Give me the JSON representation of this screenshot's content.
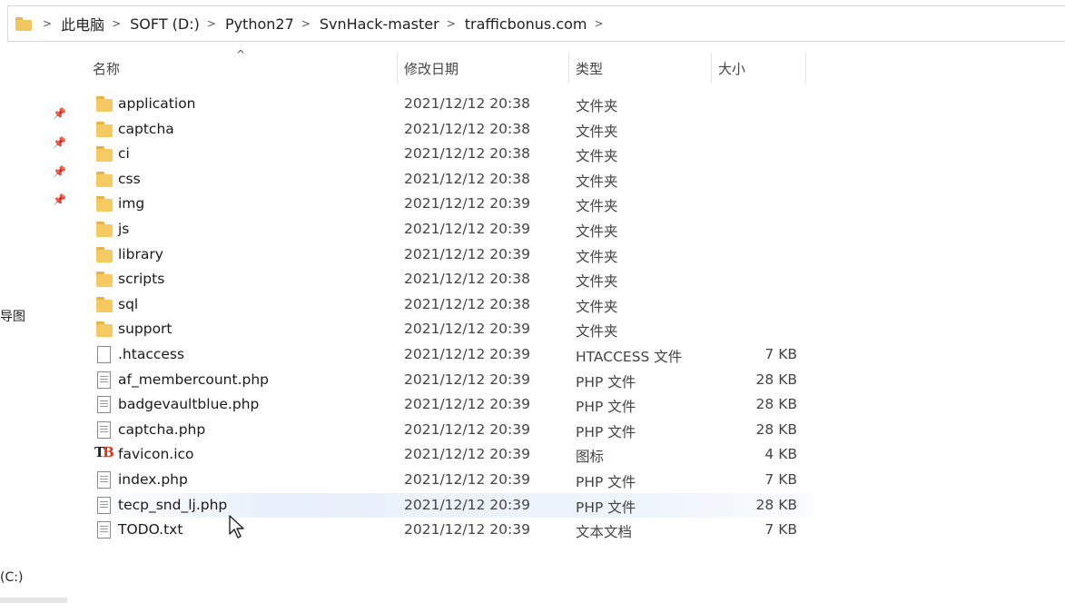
{
  "breadcrumb": [
    "此电脑",
    "SOFT (D:)",
    "Python27",
    "SvnHack-master",
    "trafficbonus.com"
  ],
  "columns": {
    "name": "名称",
    "date": "修改日期",
    "type": "类型",
    "size": "大小"
  },
  "nav_fragments": {
    "pane_item_1": "导图",
    "drive_c": "(C:)"
  },
  "files": [
    {
      "name": "application",
      "date": "2021/12/12 20:38",
      "type": "文件夹",
      "size": "",
      "icon": "folder-icon"
    },
    {
      "name": "captcha",
      "date": "2021/12/12 20:38",
      "type": "文件夹",
      "size": "",
      "icon": "folder-icon"
    },
    {
      "name": "ci",
      "date": "2021/12/12 20:38",
      "type": "文件夹",
      "size": "",
      "icon": "folder-icon"
    },
    {
      "name": "css",
      "date": "2021/12/12 20:38",
      "type": "文件夹",
      "size": "",
      "icon": "folder-icon"
    },
    {
      "name": "img",
      "date": "2021/12/12 20:39",
      "type": "文件夹",
      "size": "",
      "icon": "folder-icon"
    },
    {
      "name": "js",
      "date": "2021/12/12 20:39",
      "type": "文件夹",
      "size": "",
      "icon": "folder-icon"
    },
    {
      "name": "library",
      "date": "2021/12/12 20:39",
      "type": "文件夹",
      "size": "",
      "icon": "folder-icon"
    },
    {
      "name": "scripts",
      "date": "2021/12/12 20:38",
      "type": "文件夹",
      "size": "",
      "icon": "folder-icon"
    },
    {
      "name": "sql",
      "date": "2021/12/12 20:38",
      "type": "文件夹",
      "size": "",
      "icon": "folder-icon"
    },
    {
      "name": "support",
      "date": "2021/12/12 20:39",
      "type": "文件夹",
      "size": "",
      "icon": "folder-icon"
    },
    {
      "name": ".htaccess",
      "date": "2021/12/12 20:39",
      "type": "HTACCESS 文件",
      "size": "7 KB",
      "icon": "blank-file-icon"
    },
    {
      "name": "af_membercount.php",
      "date": "2021/12/12 20:39",
      "type": "PHP 文件",
      "size": "28 KB",
      "icon": "text-file-icon"
    },
    {
      "name": "badgevaultblue.php",
      "date": "2021/12/12 20:39",
      "type": "PHP 文件",
      "size": "28 KB",
      "icon": "text-file-icon"
    },
    {
      "name": "captcha.php",
      "date": "2021/12/12 20:39",
      "type": "PHP 文件",
      "size": "28 KB",
      "icon": "text-file-icon"
    },
    {
      "name": "favicon.ico",
      "date": "2021/12/12 20:39",
      "type": "图标",
      "size": "4 KB",
      "icon": "favicon-icon"
    },
    {
      "name": "index.php",
      "date": "2021/12/12 20:39",
      "type": "PHP 文件",
      "size": "7 KB",
      "icon": "text-file-icon"
    },
    {
      "name": "tecp_snd_lj.php",
      "date": "2021/12/12 20:39",
      "type": "PHP 文件",
      "size": "28 KB",
      "icon": "text-file-icon",
      "hovered": true
    },
    {
      "name": "TODO.txt",
      "date": "2021/12/12 20:39",
      "type": "文本文档",
      "size": "7 KB",
      "icon": "text-file-icon"
    }
  ],
  "favicon_glyph": {
    "t": "T",
    "b": "B"
  }
}
